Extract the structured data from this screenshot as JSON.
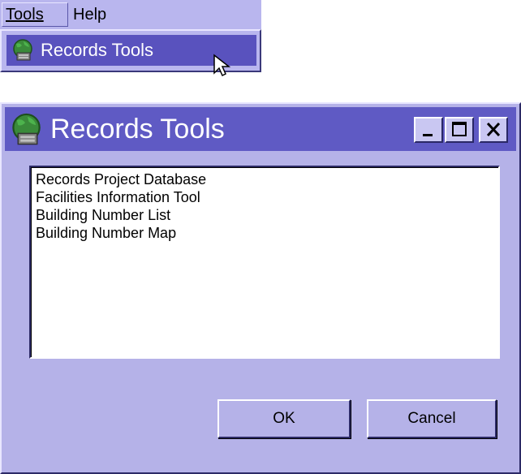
{
  "menubar": {
    "tools_label": "Tools",
    "help_label": "Help",
    "dropdown_items": [
      {
        "label": "Records Tools",
        "icon": "globe-icon"
      }
    ]
  },
  "dialog": {
    "title": "Records Tools",
    "title_icon": "globe-icon",
    "controls": [
      "minimize",
      "maximize",
      "close"
    ],
    "list_items": [
      "Records Project Database",
      "Facilities Information Tool",
      "Building Number List",
      "Building Number Map"
    ],
    "ok_label": "OK",
    "cancel_label": "Cancel"
  },
  "colors": {
    "window_bg": "#b5b2e8",
    "titlebar": "#5f5ac4",
    "highlight": "#5952be",
    "menu_bg": "#b9b6ee"
  }
}
